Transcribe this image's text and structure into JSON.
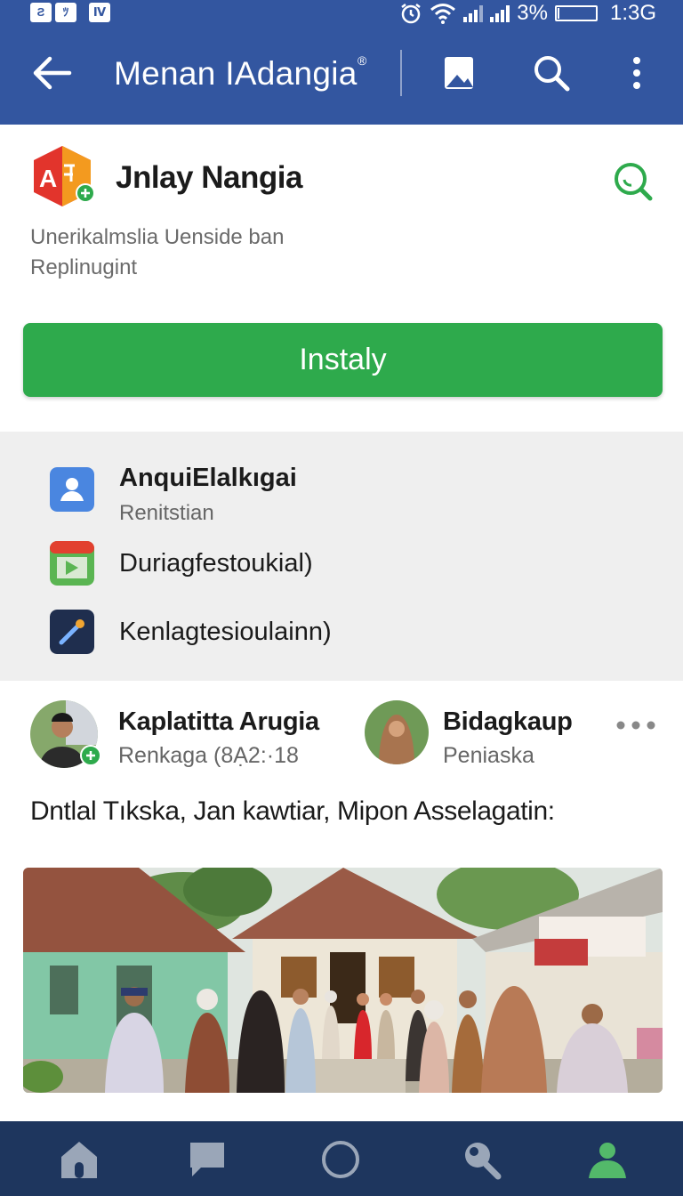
{
  "status": {
    "notif_icons": [
      "Ƨ",
      "ﾂ",
      "Ⅳ"
    ],
    "battery_text": "3%",
    "time": "1:3G"
  },
  "appbar": {
    "title": "Menan IAdangia",
    "title_sup": "®"
  },
  "app": {
    "name": "Jnlay Nangia",
    "desc_line1": "Unerikalmslia Uenside ban",
    "desc_line2": "Replinugint",
    "install_label": "Instaly",
    "logo_text": "A"
  },
  "permissions": [
    {
      "title": "AnquiElalkıgai",
      "sub": "Renitstian",
      "icon": "person-icon"
    },
    {
      "title": "Duriagfestoukial)",
      "sub": "",
      "icon": "media-icon"
    },
    {
      "title": "Kenlagtesioulainn)",
      "sub": "",
      "icon": "tool-icon"
    }
  ],
  "post": {
    "author1_name": "Kaplatitta Arugia",
    "author1_sub": "Renkaga (8Ạ2:·18",
    "author2_name": "Bidagkaup",
    "author2_sub": "Peniaska",
    "text": "Dntlal Tıkska, Jan kawtiar, Mipon Asselagatin:"
  },
  "bottom_nav": [
    "home-icon",
    "chat-icon",
    "circle-icon",
    "search-icon",
    "profile-icon"
  ],
  "colors": {
    "appbar": "#3356a0",
    "install": "#2eaa4c",
    "bottom_nav": "#1e365e",
    "nav_active": "#53b96a"
  }
}
